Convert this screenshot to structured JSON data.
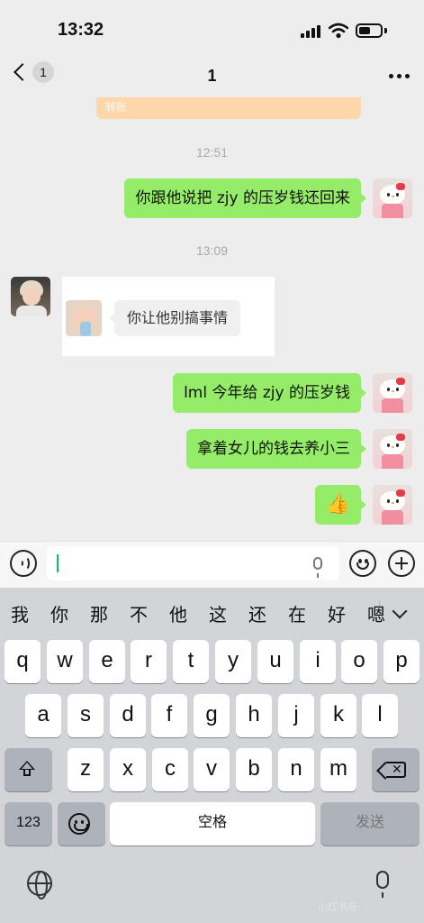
{
  "status_bar": {
    "time": "13:32",
    "battery_level_pct": 55
  },
  "nav": {
    "back_count": "1",
    "title": "1"
  },
  "chat": {
    "transfer_label": "转账",
    "timestamps": [
      "12:51",
      "13:09"
    ],
    "messages": [
      {
        "side": "right",
        "text": "你跟他说把 zjy 的压岁钱还回来",
        "avatar_icon": "hello-kitty-avatar"
      },
      {
        "side": "left",
        "quote_text": "你让他别搞事情",
        "avatar_icon": "person-avatar",
        "quote_avatar_icon": "baby-avatar"
      },
      {
        "side": "right",
        "text": "lml 今年给 zjy 的压岁钱",
        "avatar_icon": "hello-kitty-avatar"
      },
      {
        "side": "right",
        "text": "拿着女儿的钱去养小三",
        "avatar_icon": "hello-kitty-avatar"
      },
      {
        "side": "right",
        "text": "👍",
        "avatar_icon": "hello-kitty-avatar"
      }
    ]
  },
  "keyboard": {
    "candidates": [
      "我",
      "你",
      "那",
      "不",
      "他",
      "这",
      "还",
      "在",
      "好",
      "嗯"
    ],
    "row1": [
      "q",
      "w",
      "e",
      "r",
      "t",
      "y",
      "u",
      "i",
      "o",
      "p"
    ],
    "row2": [
      "a",
      "s",
      "d",
      "f",
      "g",
      "h",
      "j",
      "k",
      "l"
    ],
    "row3": [
      "z",
      "x",
      "c",
      "v",
      "b",
      "n",
      "m"
    ],
    "numbers_label": "123",
    "space_label": "空格",
    "send_label": "发送",
    "watermark": "小红书号: ..."
  },
  "colors": {
    "bubble_green": "#95ec69",
    "caret": "#07c160",
    "background": "#ededed"
  }
}
